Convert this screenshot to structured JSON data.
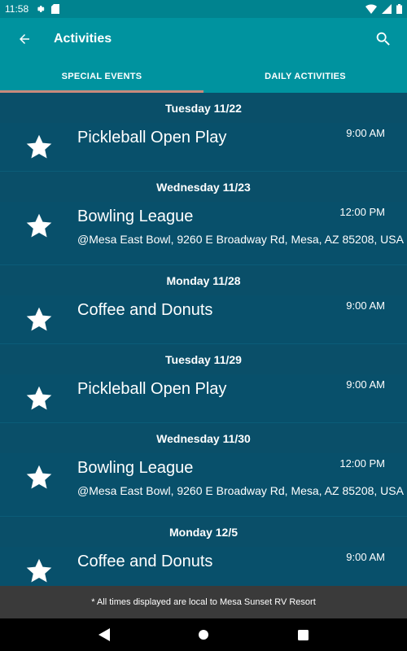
{
  "status_bar": {
    "time": "11:58"
  },
  "app_bar": {
    "title": "Activities"
  },
  "tabs": [
    {
      "label": "SPECIAL EVENTS",
      "active": true
    },
    {
      "label": "DAILY ACTIVITIES",
      "active": false
    }
  ],
  "events": [
    {
      "date": "Tuesday 11/22",
      "name": "Pickleball Open Play",
      "time": "9:00 AM",
      "location": ""
    },
    {
      "date": "Wednesday 11/23",
      "name": "Bowling League",
      "time": "12:00 PM",
      "location": "@Mesa East Bowl, 9260 E Broadway Rd, Mesa, AZ 85208, USA"
    },
    {
      "date": "Monday 11/28",
      "name": "Coffee and Donuts",
      "time": "9:00 AM",
      "location": ""
    },
    {
      "date": "Tuesday 11/29",
      "name": "Pickleball Open Play",
      "time": "9:00 AM",
      "location": ""
    },
    {
      "date": "Wednesday 11/30",
      "name": "Bowling League",
      "time": "12:00 PM",
      "location": "@Mesa East Bowl, 9260 E Broadway Rd, Mesa, AZ 85208, USA"
    },
    {
      "date": "Monday 12/5",
      "name": "Coffee and Donuts",
      "time": "9:00 AM",
      "location": ""
    }
  ],
  "footer": {
    "note": "* All times displayed are local to Mesa Sunset RV Resort"
  },
  "icons": {
    "status_left": [
      "settings-icon",
      "sd-card-icon"
    ],
    "status_right": [
      "wifi-icon",
      "signal-icon",
      "battery-icon"
    ],
    "event": "star-icon"
  },
  "colors": {
    "app_bar": "#00939f",
    "list_background": "#08506b",
    "tab_indicator": "#c98a7c",
    "footer": "#3a3a3a"
  }
}
